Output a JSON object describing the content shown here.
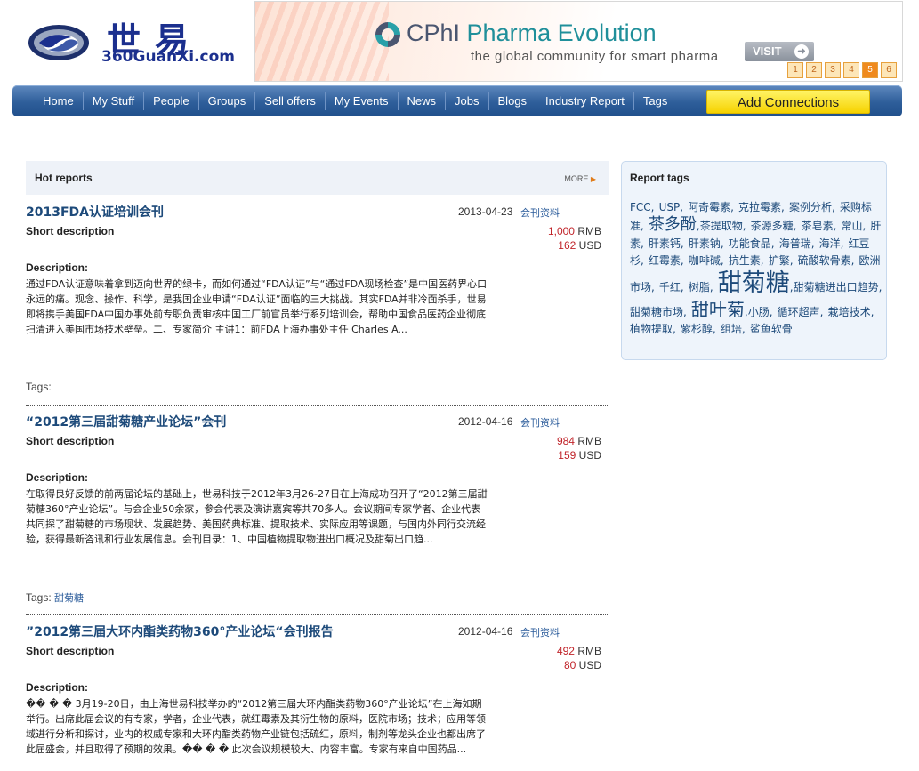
{
  "site": {
    "logo_cn": "世易",
    "logo_en": "360GuanXi.com"
  },
  "banner": {
    "brand_a": "CPhI",
    "brand_b": "Pharma Evolution",
    "subtitle": "the global community for smart pharma",
    "visit_label": "VISIT",
    "pages": [
      "1",
      "2",
      "3",
      "4",
      "5",
      "6"
    ],
    "active_page": "5"
  },
  "nav": {
    "items": [
      "Home",
      "My Stuff",
      "People",
      "Groups",
      "Sell offers",
      "My Events",
      "News",
      "Jobs",
      "Blogs",
      "Industry Report",
      "Tags"
    ],
    "add_connections": "Add Connections"
  },
  "hot": {
    "title": "Hot reports",
    "more": "MORE"
  },
  "reports": [
    {
      "title": "2013FDA认证培训会刊",
      "date": "2013-04-23",
      "category": "会刊资料",
      "short_label": "Short description",
      "price_rmb": "1,000",
      "rmb": "RMB",
      "price_usd": "162",
      "usd": "USD",
      "desc_label": "Description:",
      "description": "通过FDA认证意味着拿到迈向世界的绿卡，而如何通过“FDA认证”与“通过FDA现场检查”是中国医药界心口永远的痛。观念、操作、科学，是我国企业申请“FDA认证”面临的三大挑战。其实FDA并非冷面杀手，世易即将携手美国FDA中国办事处前专职负责审核中国工厂前官员举行系列培训会，帮助中国食品医药企业彻底扫清进入美国市场技术壁垒。二、专家简介 主讲1：前FDA上海办事处主任 Charles A...",
      "tags_label": "Tags:",
      "tags": ""
    },
    {
      "title": "“2012第三届甜菊糖产业论坛”会刊",
      "date": "2012-04-16",
      "category": "会刊资料",
      "short_label": "Short description",
      "price_rmb": "984",
      "rmb": "RMB",
      "price_usd": "159",
      "usd": "USD",
      "desc_label": "Description:",
      "description": "在取得良好反馈的前两届论坛的基础上，世易科技于2012年3月26-27日在上海成功召开了“2012第三届甜菊糖360°产业论坛”。与会企业50余家，参会代表及演讲嘉宾等共70多人。会议期间专家学者、企业代表共同探了甜菊糖的市场现状、发展趋势、美国药典标准、提取技术、实际应用等课题，与国内外同行交流经验，获得最新咨讯和行业发展信息。会刊目录：1、中国植物提取物进出口概况及甜菊出口趋...",
      "tags_label": "Tags:",
      "tags": "甜菊糖"
    },
    {
      "title": "”2012第三届大环内酯类药物360°产业论坛“会刊报告",
      "date": "2012-04-16",
      "category": "会刊资料",
      "short_label": "Short description",
      "price_rmb": "492",
      "rmb": "RMB",
      "price_usd": "80",
      "usd": "USD",
      "desc_label": "Description:",
      "description": "�� � � 3月19-20日，由上海世易科技举办的“2012第三届大环内酯类药物360°产业论坛”在上海如期举行。出席此届会议的有专家，学者，企业代表，就红霉素及其衍生物的原料，医院市场；技术；应用等领域进行分析和探讨，业内的权威专家和大环内酯类药物产业链包括硫红，原料，制剂等龙头企业也都出席了此届盛会，并且取得了预期的效果。�� � � 此次会议规模较大、内容丰富。专家有来自中国药品..."
    }
  ],
  "sidebar": {
    "title": "Report tags",
    "tags": [
      {
        "text": "FCC,",
        "size": "s"
      },
      {
        "text": "USP,",
        "size": "s"
      },
      {
        "text": "阿奇霉素,",
        "size": "s"
      },
      {
        "text": "克拉霉素,",
        "size": "s"
      },
      {
        "text": "案例分析,",
        "size": "s"
      },
      {
        "text": "采购标准,",
        "size": "s"
      },
      {
        "text": "茶多酚",
        "size": "m"
      },
      {
        "text": ",茶提取物,",
        "size": "s"
      },
      {
        "text": "茶源多糖,",
        "size": "s"
      },
      {
        "text": "茶皂素,",
        "size": "s"
      },
      {
        "text": "常山,",
        "size": "s"
      },
      {
        "text": "肝素,",
        "size": "s"
      },
      {
        "text": "肝素钙,",
        "size": "s"
      },
      {
        "text": "肝素钠,",
        "size": "s"
      },
      {
        "text": "功能食品,",
        "size": "s"
      },
      {
        "text": "海普瑞,",
        "size": "s"
      },
      {
        "text": "海洋,",
        "size": "s"
      },
      {
        "text": "红豆杉,",
        "size": "s"
      },
      {
        "text": "红霉素,",
        "size": "s"
      },
      {
        "text": "咖啡碱,",
        "size": "s"
      },
      {
        "text": "抗生素,",
        "size": "s"
      },
      {
        "text": "扩繁,",
        "size": "s"
      },
      {
        "text": "硫酸软骨素,",
        "size": "s"
      },
      {
        "text": "欧洲市场,",
        "size": "s"
      },
      {
        "text": "千红,",
        "size": "s"
      },
      {
        "text": "树脂,",
        "size": "s"
      },
      {
        "text": "甜菊糖",
        "size": "l"
      },
      {
        "text": ",甜菊糖进出口趋势,",
        "size": "s"
      },
      {
        "text": "甜菊糖市场,",
        "size": "s"
      },
      {
        "text": "甜叶菊",
        "size": "ml"
      },
      {
        "text": ",小肠,",
        "size": "s"
      },
      {
        "text": "循环超声,",
        "size": "s"
      },
      {
        "text": "栽培技术,",
        "size": "s"
      },
      {
        "text": "植物提取,",
        "size": "s"
      },
      {
        "text": "紫杉醇,",
        "size": "s"
      },
      {
        "text": "组培,",
        "size": "s"
      },
      {
        "text": "鲨鱼软骨",
        "size": "s"
      }
    ]
  },
  "colors": {
    "nav_blue": "#2e5e9a",
    "add_btn_yellow": "#f6d200",
    "link_blue": "#1d4a7a",
    "price_red": "#c0242a",
    "pager_active": "#ef8a1e"
  }
}
